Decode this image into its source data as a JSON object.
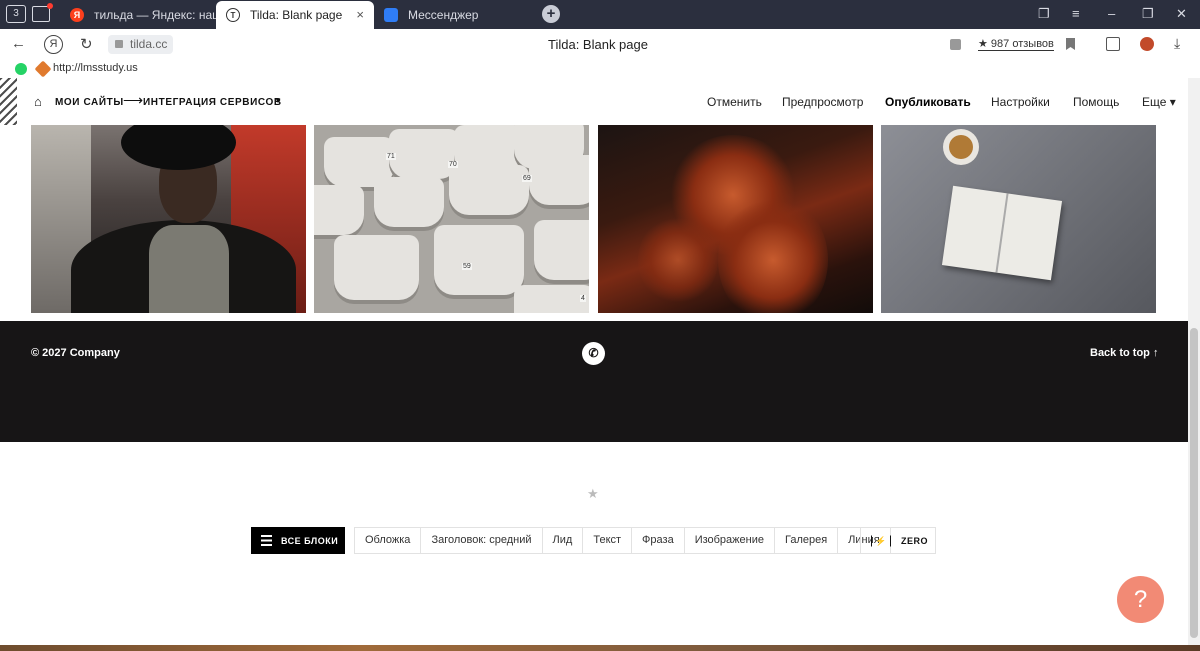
{
  "browser": {
    "tab_count": "3",
    "tabs": [
      {
        "label": "тильда — Яндекс: нашлось",
        "favicon": "Я"
      },
      {
        "label": "Tilda: Blank page",
        "favicon": "T",
        "close": "×"
      },
      {
        "label": "Мессенджер"
      }
    ],
    "address": "tilda.cc",
    "page_title": "Tilda: Blank page",
    "reviews": "★ 987 отзывов",
    "bookmark": "http://lmsstudy.us",
    "yandex_icon": "Я"
  },
  "tilda_panel": {
    "breadcrumb": {
      "sites": "МОИ САЙТЫ",
      "arrow": "⟶",
      "project": "ИНТЕГРАЦИЯ СЕРВИСОВ"
    },
    "menu": {
      "cancel": "Отменить",
      "preview": "Предпросмотр",
      "publish": "Опубликовать",
      "settings": "Настройки",
      "help": "Помощь",
      "more": "Еще ▾"
    }
  },
  "gallery": {
    "seat_numbers": [
      "70",
      "71",
      "69",
      "59",
      "4"
    ]
  },
  "footer": {
    "copyright": "© 2027 Company",
    "back_to_top": "Back to top ↑"
  },
  "blocks_panel": {
    "all_blocks": "ВСЕ БЛОКИ",
    "items": [
      "Обложка",
      "Заголовок: средний",
      "Лид",
      "Текст",
      "Фраза",
      "Изображение",
      "Галерея",
      "Линия"
    ],
    "zero": "ZERO",
    "help": "?"
  },
  "colors": {
    "tab_strip": "#2b2f3e",
    "footer": "#171516",
    "help_button": "#f28a75"
  }
}
